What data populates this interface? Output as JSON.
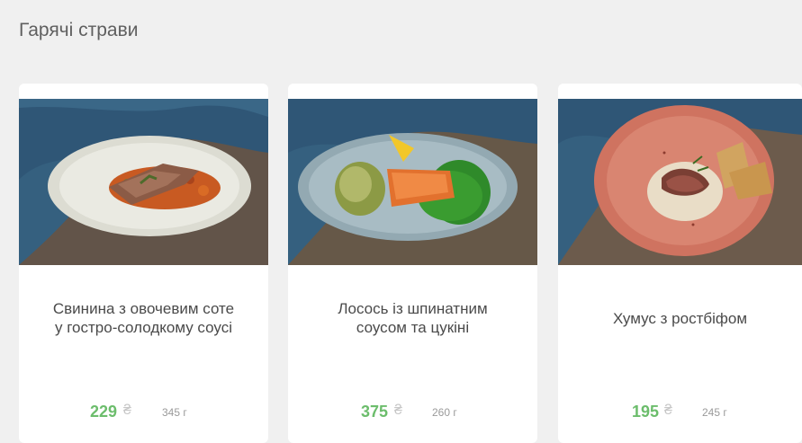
{
  "section": {
    "title": "Гарячі страви"
  },
  "colors": {
    "price": "#6cbd6c",
    "card_bg": "#ffffff",
    "page_bg": "#f0f0f0"
  },
  "products": [
    {
      "name_line1": "Свинина з овочевим соте",
      "name_line2": "у гостро-солодкому соусі",
      "price": "229",
      "currency": "₴",
      "weight": "345 г",
      "image": "pork-with-vegetable-saute-photo"
    },
    {
      "name_line1": "Лосось із шпинатним",
      "name_line2": "соусом та цукіні",
      "price": "375",
      "currency": "₴",
      "weight": "260 г",
      "image": "salmon-with-spinach-sauce-photo"
    },
    {
      "name_line1": "Хумус з ростбіфом",
      "name_line2": "",
      "price": "195",
      "currency": "₴",
      "weight": "245 г",
      "image": "hummus-with-roast-beef-photo"
    }
  ]
}
